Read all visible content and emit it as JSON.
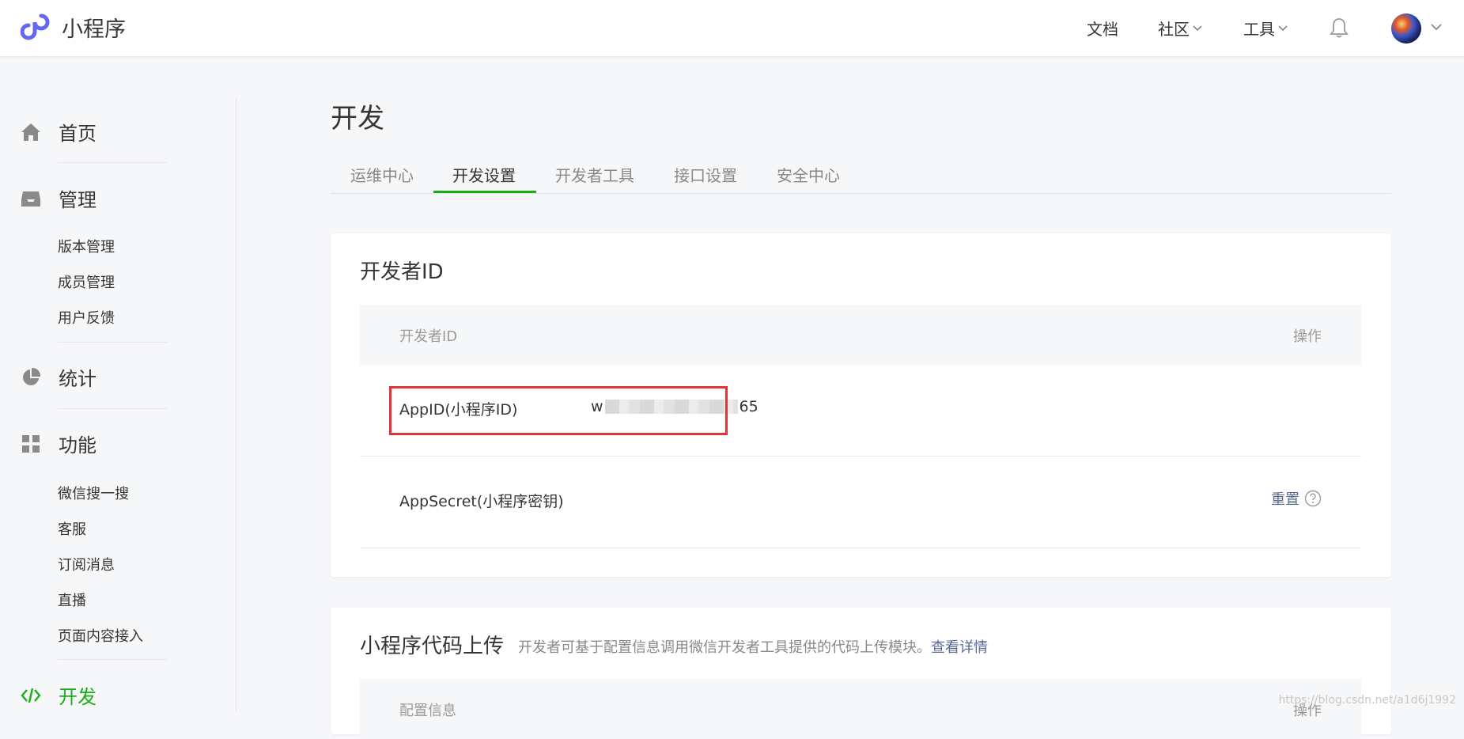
{
  "header": {
    "brand_name": "小程序",
    "nav": {
      "docs": "文档",
      "community": "社区",
      "tools": "工具"
    },
    "icons": {
      "logo": "mini-program-logo-icon",
      "bell": "bell-icon",
      "chevron": "chevron-down-icon"
    }
  },
  "sidebar": {
    "home": "首页",
    "manage": "管理",
    "manage_items": [
      "版本管理",
      "成员管理",
      "用户反馈"
    ],
    "stats": "统计",
    "features": "功能",
    "feature_items": [
      "微信搜一搜",
      "客服",
      "订阅消息",
      "直播",
      "页面内容接入"
    ],
    "develop": "开发"
  },
  "main": {
    "title": "开发",
    "tabs": [
      "运维中心",
      "开发设置",
      "开发者工具",
      "接口设置",
      "安全中心"
    ],
    "active_tab": "开发设置"
  },
  "developer_id_card": {
    "title": "开发者ID",
    "columns": [
      "开发者ID",
      "操作"
    ],
    "rows": [
      {
        "label": "AppID(小程序ID)",
        "value_prefix": "w",
        "value_suffix": "65"
      },
      {
        "label": "AppSecret(小程序密钥)",
        "action": "重置"
      }
    ]
  },
  "upload_card": {
    "title": "小程序代码上传",
    "description": "开发者可基于配置信息调用微信开发者工具提供的代码上传模块。",
    "link": "查看详情",
    "columns": [
      "配置信息",
      "操作"
    ]
  },
  "watermark": "https://blog.csdn.net/a1d6j1992",
  "colors": {
    "accent_green": "#1aad19",
    "link_blue": "#576b95",
    "highlight_red": "#e53333"
  }
}
